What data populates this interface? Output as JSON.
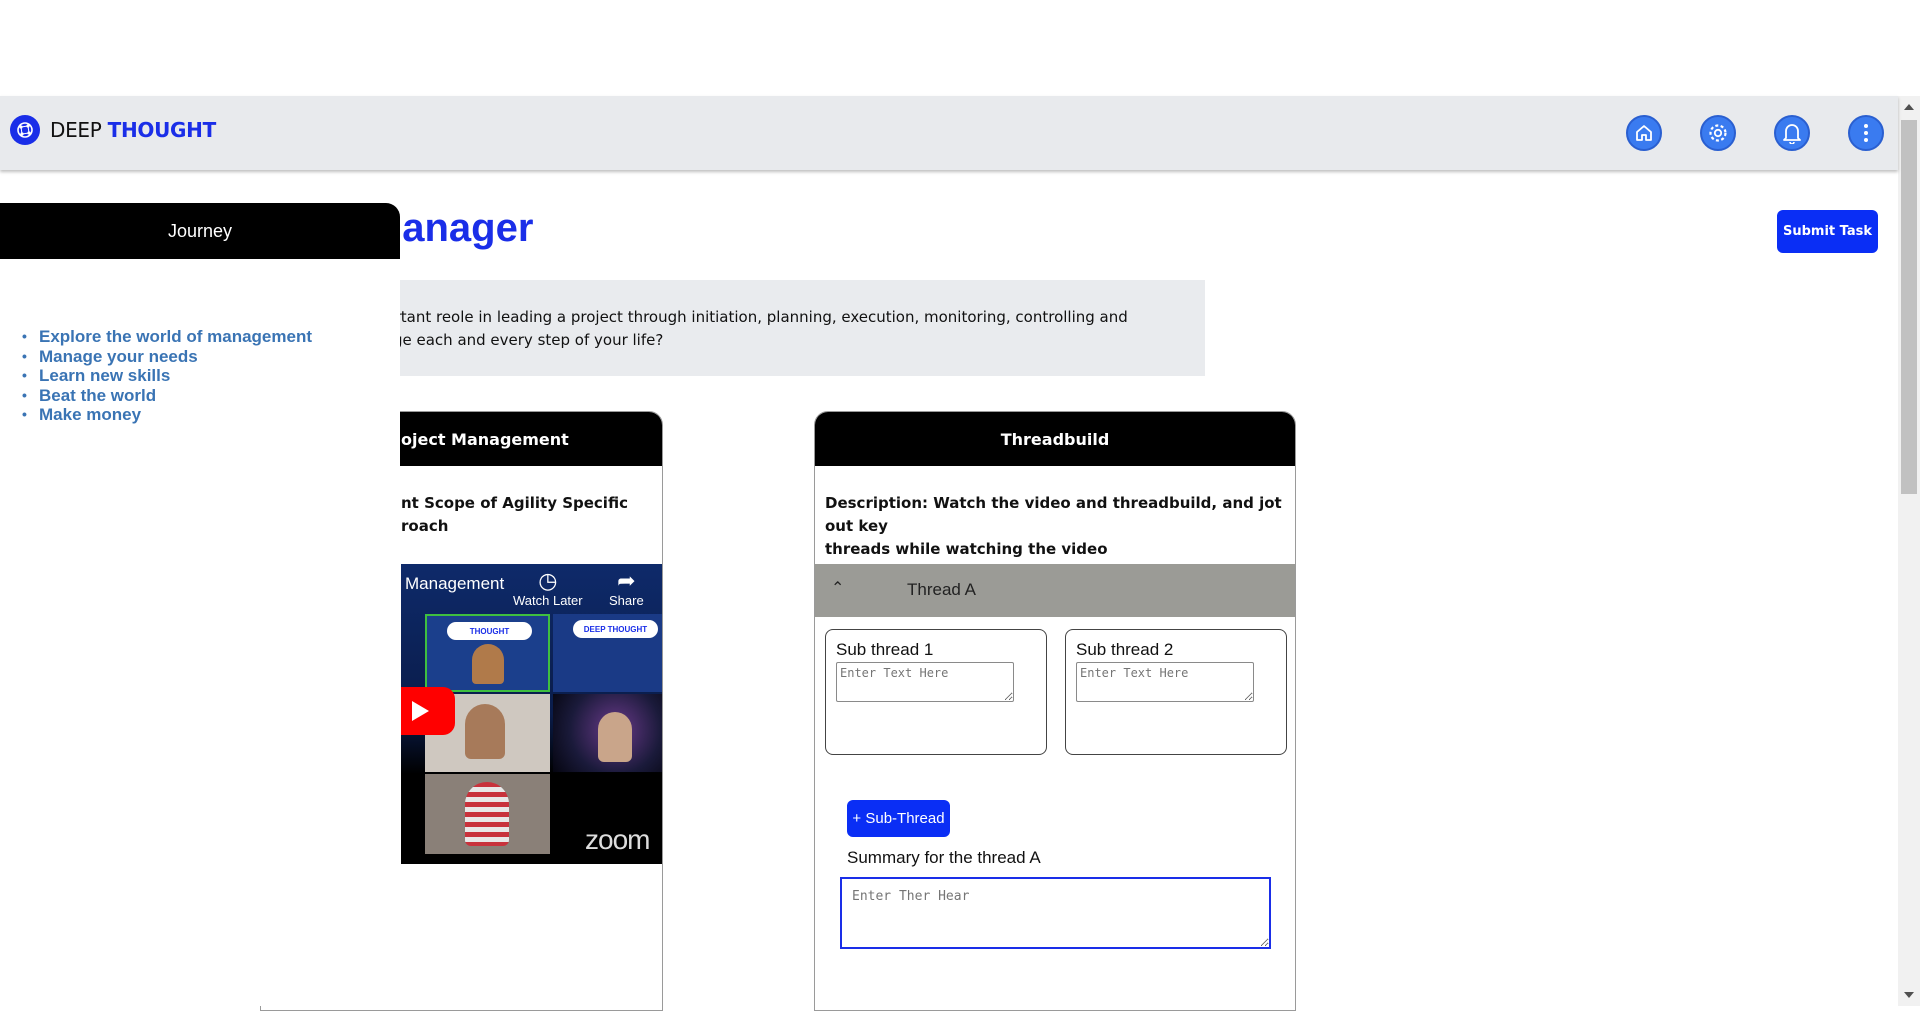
{
  "brand": {
    "prefix": "DEEP",
    "highlight": "THOUGHT"
  },
  "nav_icons": [
    "home-icon",
    "settings-icon",
    "bell-icon",
    "more-vertical-icon"
  ],
  "page": {
    "title": "ect Manager",
    "submit_label": "Submit Task",
    "description_lines": [
      "y an important reole in leading a project through initiation, planning, execution, monitoring, controlling and",
      "t to manage each and every step of your life?"
    ]
  },
  "sidebar": {
    "title": "Journey",
    "items": [
      "Explore the world of management",
      "Manage your needs",
      "Learn new skills",
      "Beat the world",
      "Make money"
    ]
  },
  "card_pm": {
    "title": "oject Management",
    "description_lines": [
      "nt Scope of Agility Specific",
      "roach"
    ],
    "video": {
      "title": "Management",
      "watch_later": "Watch Later",
      "share": "Share",
      "badges": [
        "THOUGHT",
        "DEEP THOUGHT"
      ],
      "watermark": "zoom"
    }
  },
  "card_thread": {
    "title": "Threadbuild",
    "description_lines": [
      "Description: Watch the video and threadbuild, and jot out key",
      "threads while watching the video"
    ],
    "thread_label": "Thread A",
    "subthreads": [
      {
        "title": "Sub thread 1",
        "placeholder": "Enter Text Here"
      },
      {
        "title": "Sub thread 2",
        "placeholder": "Enter Text Here"
      }
    ],
    "add_subthread_label": "+ Sub-Thread",
    "summary_label": "Summary for the thread A",
    "summary_placeholder": "Enter Ther Hear"
  },
  "colors": {
    "brand_blue": "#1a2ee8",
    "button_blue": "#0a2ef5",
    "link_blue": "#3a74b4",
    "nav_icon_blue": "#3a7bf0"
  }
}
